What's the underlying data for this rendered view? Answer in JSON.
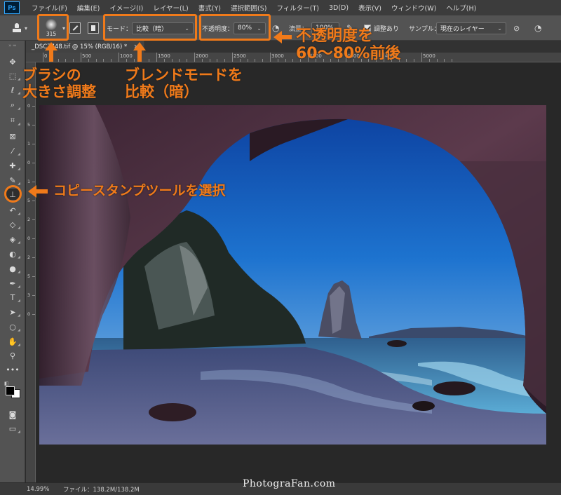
{
  "app": {
    "logo": "Ps"
  },
  "menu": [
    "ファイル(F)",
    "編集(E)",
    "イメージ(I)",
    "レイヤー(L)",
    "書式(Y)",
    "選択範囲(S)",
    "フィルター(T)",
    "3D(D)",
    "表示(V)",
    "ウィンドウ(W)",
    "ヘルプ(H)"
  ],
  "options": {
    "brush_size": "315",
    "mode_label": "モード：",
    "mode_value": "比較（暗）",
    "opacity_label": "不透明度：",
    "opacity_value": "80%",
    "flow_label": "流量：",
    "flow_value": "100%",
    "aligned_label": "調整あり",
    "sample_label": "サンプル：",
    "sample_value": "現在のレイヤー"
  },
  "document": {
    "tab_title": "_DSC7748.tif @ 15% (RGB/16) *",
    "close_glyph": "×",
    "ruler_h_labels": [
      "0",
      "500",
      "1000",
      "1500",
      "2000",
      "2500",
      "3000",
      "3500",
      "4000",
      "4500",
      "5000"
    ],
    "ruler_v_labels": [
      "0",
      "5",
      "1",
      "0",
      "1",
      "5",
      "2",
      "0",
      "2",
      "5",
      "3",
      "0"
    ]
  },
  "status": {
    "zoom": "14.99%",
    "file_info": "ファイル：138.2M/138.2M"
  },
  "annotations": {
    "brush_line1": "ブラシの",
    "brush_line2": "大きさ調整",
    "blend_line1": "ブレンドモードを",
    "blend_line2": "比較（暗）",
    "opacity_line1": "不透明度を",
    "opacity_line2": "60～80%前後",
    "stamp": "コピースタンプツールを選択",
    "accent_color": "#f07a1a"
  },
  "watermark": "PhotograFan.com",
  "toolbar_icons": [
    "move-tool-icon",
    "marquee-tool-icon",
    "lasso-tool-icon",
    "quick-select-tool-icon",
    "crop-tool-icon",
    "frame-tool-icon",
    "eyedropper-tool-icon",
    "healing-brush-tool-icon",
    "brush-tool-icon",
    "clone-stamp-tool-icon",
    "history-brush-tool-icon",
    "eraser-tool-icon",
    "paint-bucket-tool-icon",
    "blur-tool-icon",
    "dodge-tool-icon",
    "pen-tool-icon",
    "type-tool-icon",
    "path-select-tool-icon",
    "ellipse-tool-icon",
    "hand-tool-icon",
    "zoom-tool-icon",
    "more-tools-icon",
    "color-swatches-icon",
    "quick-mask-icon",
    "screen-mode-icon"
  ]
}
